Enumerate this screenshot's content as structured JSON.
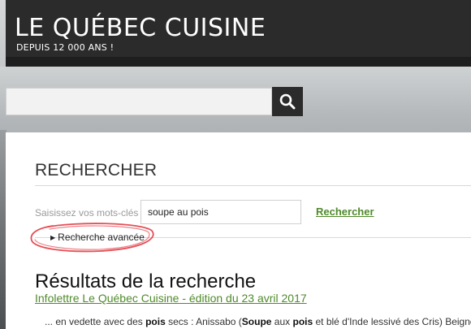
{
  "site": {
    "title": "LE QUÉBEC CUISINE",
    "tagline": "DEPUIS 12 000 ANS !"
  },
  "top_search": {
    "value": "",
    "placeholder": "",
    "button_icon": "search-icon"
  },
  "page": {
    "heading": "RECHERCHER"
  },
  "search_form": {
    "label": "Saisissez vos mots-clés",
    "value": "soupe au pois",
    "submit_label": "Rechercher",
    "advanced_label": "Recherche avancée"
  },
  "results": {
    "heading": "Résultats de la recherche",
    "items": [
      {
        "title": "Infolettre Le Québec Cuisine - édition du 23 avril 2017",
        "snippet": {
          "t1": "... en vedette avec des ",
          "b1": "pois",
          "t2": " secs : Anissabo (",
          "b2": "Soupe",
          "t3": " aux ",
          "b3": "pois",
          "t4": " et blé d'Inde lessivé des Cris) Beignets"
        }
      }
    ]
  },
  "colors": {
    "header_bg": "#2b2b2b",
    "link_green": "#4f8a2a",
    "annotation_red": "#e0303a"
  }
}
